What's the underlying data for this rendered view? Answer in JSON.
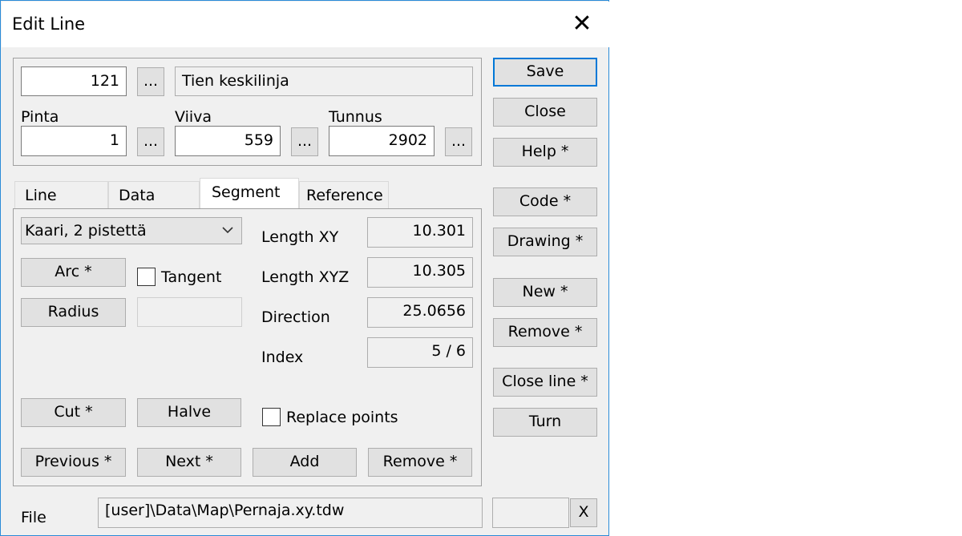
{
  "window": {
    "title": "Edit Line",
    "close_glyph": "✕"
  },
  "header": {
    "number_value": "121",
    "browse_label": "...",
    "name_value": "Tien keskilinja",
    "pinta_label": "Pinta",
    "pinta_value": "1",
    "viiva_label": "Viiva",
    "viiva_value": "559",
    "tunnus_label": "Tunnus",
    "tunnus_value": "2902"
  },
  "tabs": [
    {
      "label": "Line"
    },
    {
      "label": "Data"
    },
    {
      "label": "Segment"
    },
    {
      "label": "Reference"
    }
  ],
  "segment": {
    "type_value": "Kaari, 2 pistettä",
    "arc_label": "Arc *",
    "tangent_label": "Tangent",
    "radius_label": "Radius",
    "radius_value": "",
    "length_xy_label": "Length XY",
    "length_xy_value": "10.301",
    "length_xyz_label": "Length XYZ",
    "length_xyz_value": "10.305",
    "direction_label": "Direction",
    "direction_value": "25.0656",
    "index_label": "Index",
    "index_value": "5 / 6",
    "cut_label": "Cut *",
    "halve_label": "Halve",
    "replace_points_label": "Replace points",
    "previous_label": "Previous *",
    "next_label": "Next *",
    "add_label": "Add",
    "remove_label": "Remove *"
  },
  "sidebar": {
    "save_label": "Save",
    "close_label": "Close",
    "help_label": "Help *",
    "code_label": "Code *",
    "drawing_label": "Drawing *",
    "new_label": "New *",
    "remove_label": "Remove *",
    "close_line_label": "Close line *",
    "turn_label": "Turn"
  },
  "footer": {
    "file_label": "File",
    "file_value": "[user]\\Data\\Map\\Pernaja.xy.tdw",
    "clear_label": "X"
  }
}
